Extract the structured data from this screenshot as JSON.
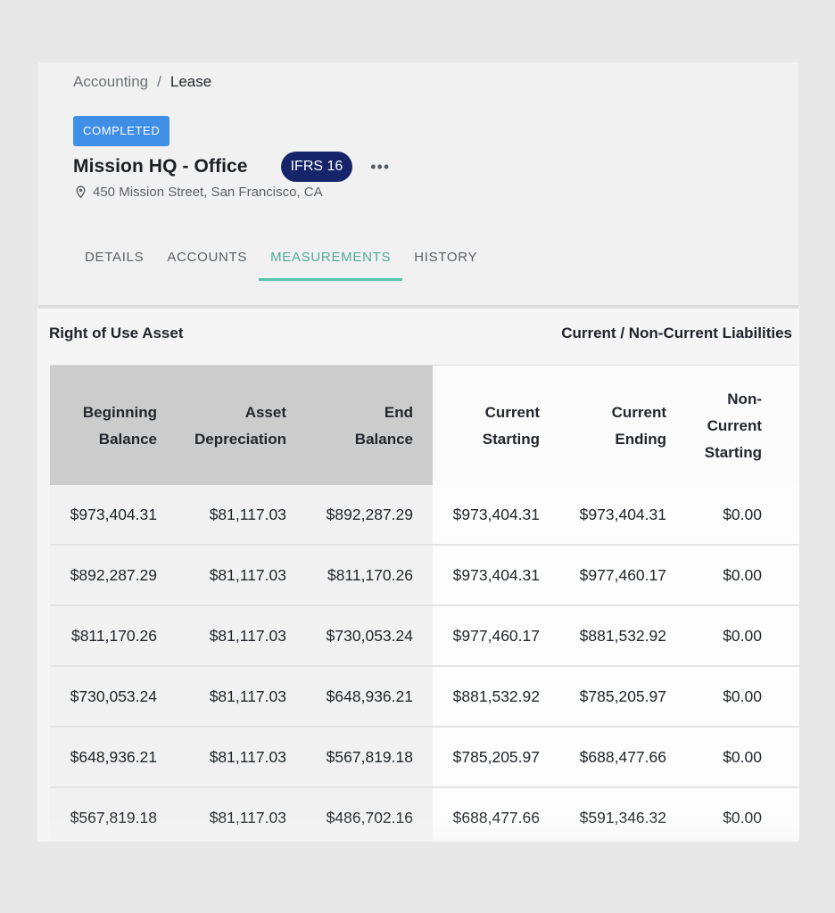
{
  "breadcrumb": {
    "parent": "Accounting",
    "separator": "/",
    "current": "Lease"
  },
  "status_badge": "COMPLETED",
  "lease": {
    "title": "Mission HQ - Office",
    "standard": "IFRS 16",
    "more": "•••",
    "address": "450 Mission Street, San Francisco, CA"
  },
  "tabs": [
    {
      "label": "DETAILS"
    },
    {
      "label": "ACCOUNTS"
    },
    {
      "label": "MEASUREMENTS"
    },
    {
      "label": "HISTORY"
    }
  ],
  "active_tab": "MEASUREMENTS",
  "sections": {
    "left": "Right of Use Asset",
    "right": "Current / Non-Current Liabilities"
  },
  "columns": [
    [
      "Beginning",
      "Balance"
    ],
    [
      "Asset",
      "Depreciation"
    ],
    [
      "End",
      "Balance"
    ],
    [
      "Current",
      "Starting"
    ],
    [
      "Current",
      "Ending"
    ],
    [
      "Non-",
      "Current",
      "Starting"
    ]
  ],
  "rows": [
    [
      "$973,404.31",
      "$81,117.03",
      "$892,287.29",
      "$973,404.31",
      "$973,404.31",
      "$0.00"
    ],
    [
      "$892,287.29",
      "$81,117.03",
      "$811,170.26",
      "$973,404.31",
      "$977,460.17",
      "$0.00"
    ],
    [
      "$811,170.26",
      "$81,117.03",
      "$730,053.24",
      "$977,460.17",
      "$881,532.92",
      "$0.00"
    ],
    [
      "$730,053.24",
      "$81,117.03",
      "$648,936.21",
      "$881,532.92",
      "$785,205.97",
      "$0.00"
    ],
    [
      "$648,936.21",
      "$81,117.03",
      "$567,819.18",
      "$785,205.97",
      "$688,477.66",
      "$0.00"
    ],
    [
      "$567,819.18",
      "$81,117.03",
      "$486,702.16",
      "$688,477.66",
      "$591,346.32",
      "$0.00"
    ]
  ],
  "colors": {
    "badge_blue": "#3f8fe6",
    "standard_navy": "#16246a",
    "tab_active": "#4fa99a"
  }
}
